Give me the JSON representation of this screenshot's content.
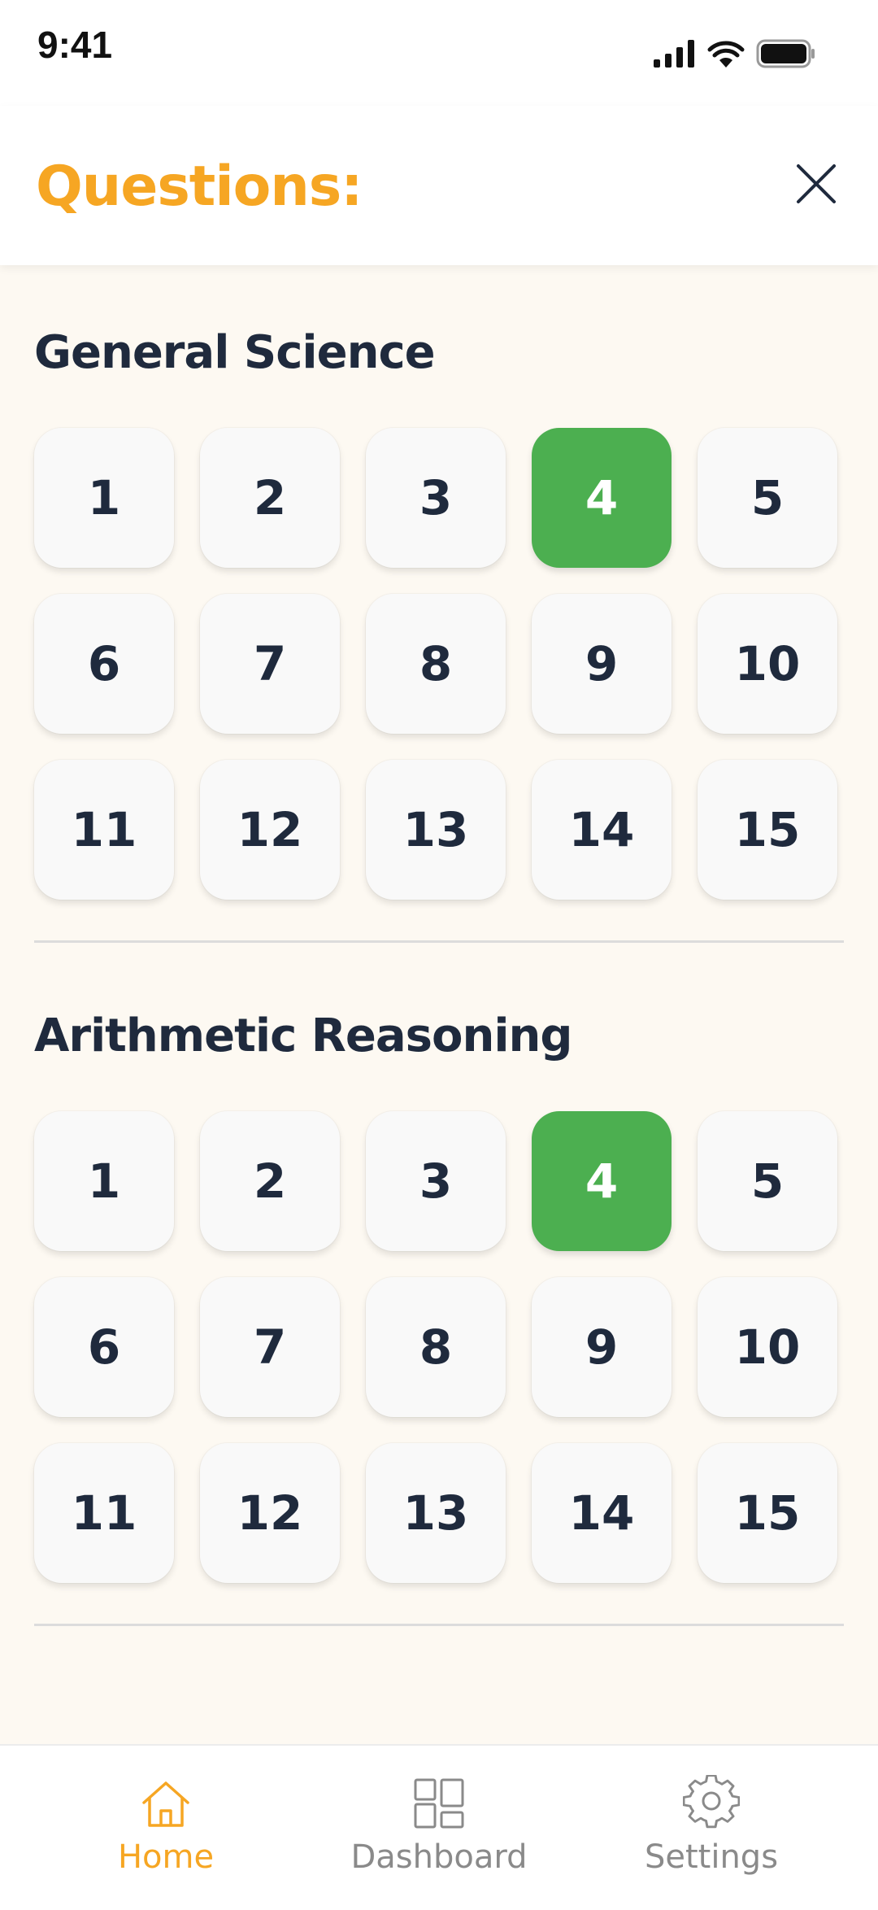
{
  "status_bar": {
    "time": "9:41"
  },
  "header": {
    "title": "Questions:"
  },
  "sections": [
    {
      "title": "General Science",
      "questions": [
        "1",
        "2",
        "3",
        "4",
        "5",
        "6",
        "7",
        "8",
        "9",
        "10",
        "11",
        "12",
        "13",
        "14",
        "15"
      ],
      "active_question": "4"
    },
    {
      "title": "Arithmetic Reasoning",
      "questions": [
        "1",
        "2",
        "3",
        "4",
        "5",
        "6",
        "7",
        "8",
        "9",
        "10",
        "11",
        "12",
        "13",
        "14",
        "15"
      ],
      "active_question": "4"
    }
  ],
  "bottom_nav": {
    "items": [
      {
        "label": "Home",
        "icon": "home-icon",
        "active": true
      },
      {
        "label": "Dashboard",
        "icon": "dashboard-icon",
        "active": false
      },
      {
        "label": "Settings",
        "icon": "settings-icon",
        "active": false
      }
    ]
  },
  "colors": {
    "accent": "#f6a623",
    "active_question": "#4caf50",
    "text_dark": "#1f2a3d",
    "background": "#fdf9f2",
    "nav_inactive": "#8a8a8a"
  }
}
